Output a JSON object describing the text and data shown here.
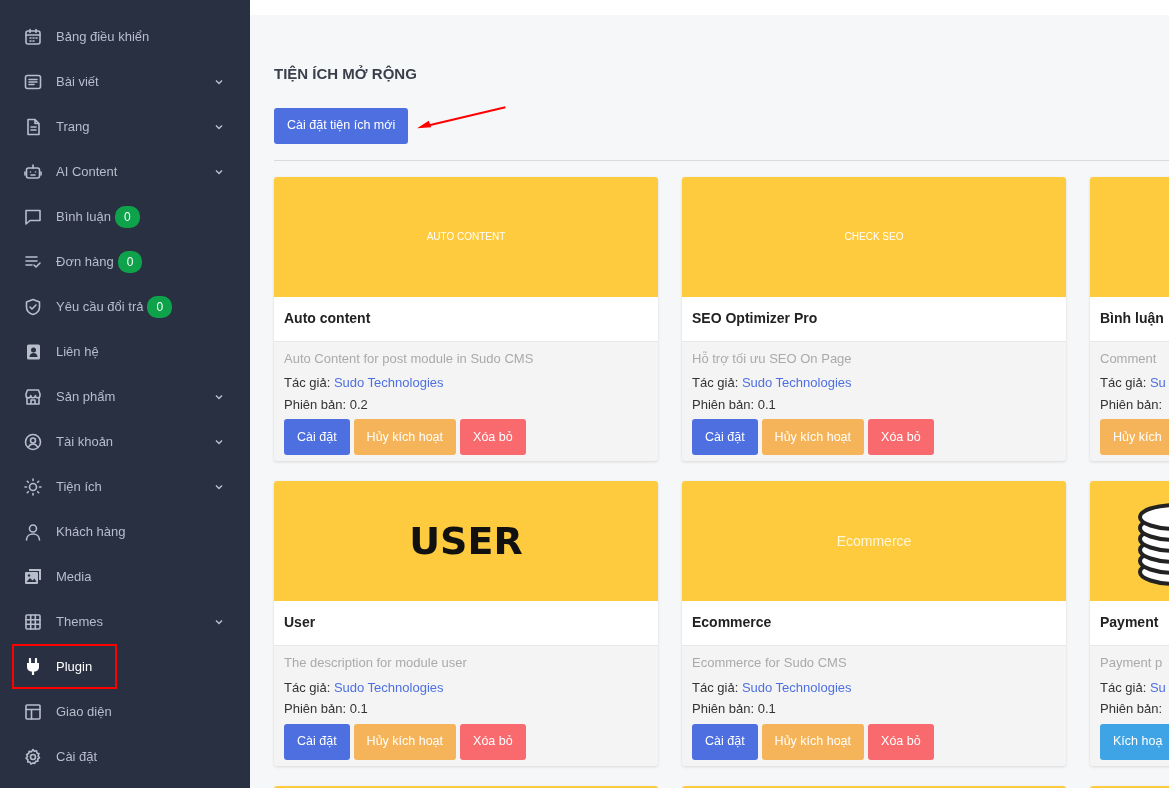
{
  "sidebar": {
    "items": [
      {
        "label": "Bảng điều khiển",
        "expandable": false,
        "selected": false,
        "highlighted": false
      },
      {
        "label": "Bài viết",
        "expandable": true,
        "selected": false,
        "highlighted": false
      },
      {
        "label": "Trang",
        "expandable": true,
        "selected": false,
        "highlighted": false
      },
      {
        "label": "AI Content",
        "expandable": true,
        "selected": false,
        "highlighted": false
      },
      {
        "label": "Bình luận",
        "badge": "0",
        "expandable": false,
        "selected": false,
        "highlighted": false
      },
      {
        "label": "Đơn hàng",
        "badge": "0",
        "expandable": false,
        "selected": false,
        "highlighted": false
      },
      {
        "label": "Yêu cầu đổi trả",
        "badge": "0",
        "expandable": false,
        "selected": false,
        "highlighted": false
      },
      {
        "label": "Liên hệ",
        "expandable": false,
        "selected": false,
        "highlighted": false
      },
      {
        "label": "Sản phẩm",
        "expandable": true,
        "selected": false,
        "highlighted": false
      },
      {
        "label": "Tài khoản",
        "expandable": true,
        "selected": false,
        "highlighted": false
      },
      {
        "label": "Tiện ích",
        "expandable": true,
        "selected": false,
        "highlighted": false
      },
      {
        "label": "Khách hàng",
        "expandable": false,
        "selected": false,
        "highlighted": false
      },
      {
        "label": "Media",
        "expandable": false,
        "selected": false,
        "highlighted": false
      },
      {
        "label": "Themes",
        "expandable": true,
        "selected": false,
        "highlighted": false
      },
      {
        "label": "Plugin",
        "expandable": false,
        "selected": true,
        "highlighted": true
      },
      {
        "label": "Giao diện",
        "expandable": false,
        "selected": false,
        "highlighted": false
      },
      {
        "label": "Cài đặt",
        "expandable": false,
        "selected": false,
        "highlighted": false
      }
    ]
  },
  "page_title": "TIỆN ÍCH MỞ RỘNG",
  "new_button": "Cài đặt tiện ích mới",
  "plugins": [
    {
      "banner": {
        "kind": "caption",
        "text": "AUTO CONTENT"
      },
      "title": "Auto content",
      "description": "Auto Content for post module in Sudo CMS",
      "author_label": "Tác giả:",
      "author": "Sudo Technologies",
      "version_label": "Phiên bản:",
      "version": "0.2",
      "buttons": [
        {
          "kind": "install",
          "label": "Cài đặt"
        },
        {
          "kind": "deactivate",
          "label": "Hủy kích hoạt"
        },
        {
          "kind": "delete",
          "label": "Xóa bỏ"
        }
      ]
    },
    {
      "banner": {
        "kind": "caption",
        "text": "CHECK SEO"
      },
      "title": "SEO Optimizer Pro",
      "description": "Hỗ trợ tối ưu SEO On Page",
      "author_label": "Tác giả:",
      "author": "Sudo Technologies",
      "version_label": "Phiên bản:",
      "version": "0.1",
      "buttons": [
        {
          "kind": "install",
          "label": "Cài đặt"
        },
        {
          "kind": "deactivate",
          "label": "Hủy kích hoạt"
        },
        {
          "kind": "delete",
          "label": "Xóa bỏ"
        }
      ]
    },
    {
      "banner": {
        "kind": "plain"
      },
      "title": "Bình luận",
      "description": "Comment",
      "author_label": "Tác giả:",
      "author": "Su",
      "version_label": "Phiên bản:",
      "buttons": [
        {
          "kind": "deactivate",
          "label": "Hủy kích"
        }
      ]
    },
    {
      "banner": {
        "kind": "logo",
        "text": "USER"
      },
      "title": "User",
      "description": "The description for module user",
      "author_label": "Tác giả:",
      "author": "Sudo Technologies",
      "version_label": "Phiên bản:",
      "version": "0.1",
      "buttons": [
        {
          "kind": "install",
          "label": "Cài đặt"
        },
        {
          "kind": "deactivate",
          "label": "Hủy kích hoạt"
        },
        {
          "kind": "delete",
          "label": "Xóa bỏ"
        }
      ]
    },
    {
      "banner": {
        "kind": "caption-large",
        "text": "Ecommerce"
      },
      "title": "Ecommerce",
      "description": "Ecommerce for Sudo CMS",
      "author_label": "Tác giả:",
      "author": "Sudo Technologies",
      "version_label": "Phiên bản:",
      "version": "0.1",
      "buttons": [
        {
          "kind": "install",
          "label": "Cài đặt"
        },
        {
          "kind": "deactivate",
          "label": "Hủy kích hoạt"
        },
        {
          "kind": "delete",
          "label": "Xóa bỏ"
        }
      ]
    },
    {
      "banner": {
        "kind": "coins"
      },
      "title": "Payment",
      "description": "Payment p",
      "author_label": "Tác giả:",
      "author": "Su",
      "version_label": "Phiên bản:",
      "buttons": [
        {
          "kind": "activate",
          "label": "Kích hoạ"
        }
      ]
    },
    {
      "banner": {
        "kind": "plain"
      }
    },
    {
      "banner": {
        "kind": "plain"
      }
    },
    {
      "banner": {
        "kind": "plain"
      }
    }
  ]
}
